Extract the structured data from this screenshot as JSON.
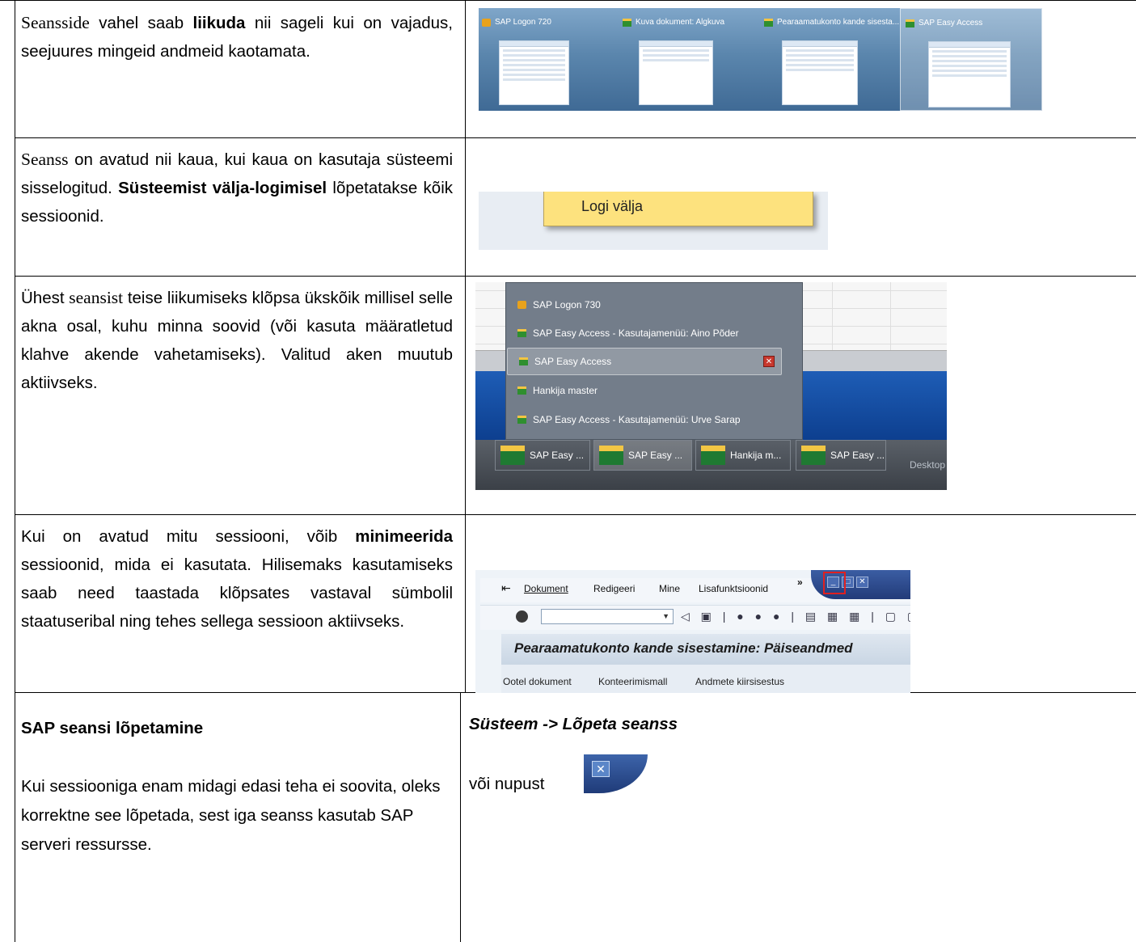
{
  "rows": [
    {
      "text_serif_lead": "Seansside",
      "text_parts": [
        " vahel saab ",
        "liikuda",
        " nii sageli kui on vajadus, seejuures mingeid andmeid kaotamata."
      ]
    },
    {
      "text_serif_lead": "Seanss",
      "text_parts": [
        " on avatud nii kaua, kui kaua on kasutaja süsteemi sisselogitud. ",
        "Süsteemist välja-logimisel",
        " lõpetatakse kõik sessioonid."
      ]
    },
    {
      "text_part1": "Ühest ",
      "text_serif": "seansist",
      "text_rest": " teise liikumiseks klõpsa ükskõik millisel selle akna osal, kuhu minna soovid (või kasuta määratletud klahve akende vahetamiseks). Valitud aken muutub aktiivseks."
    },
    {
      "text_parts": [
        "Kui on avatud mitu sessiooni, võib ",
        "minimeerida",
        " sessioonid, mida ei kasutata. Hilisemaks kasutamiseks saab need taastada klõpsates vastaval sümbolil staatuseribal ning tehes sellega sessioon aktiivseks."
      ]
    },
    {
      "heading": "SAP seansi lõpetamine",
      "text": "Kui sessiooniga enam midagi edasi teha ei soovita, oleks korrektne see lõpetada, sest iga seanss kasutab SAP serveri ressursse.",
      "right_heading": "Süsteem -> Lõpeta seanss",
      "right_text": "või nupust"
    }
  ],
  "screenshot1": {
    "thumbnails": [
      "SAP Logon 720",
      "Kuva dokument: Algkuva",
      "Pearaamatukonto kande sisesta...",
      "SAP Easy Access"
    ]
  },
  "screenshot2": {
    "menu_item": "Logi välja"
  },
  "screenshot3": {
    "items": [
      "SAP Logon 730",
      "SAP Easy Access  -  Kasutajamenüü: Aino Põder",
      "SAP Easy Access",
      "Hankija master",
      "SAP Easy Access  -  Kasutajamenüü: Urve Sarap"
    ],
    "taskbar_buttons": [
      "SAP Easy ...",
      "SAP Easy ...",
      "Hankija m...",
      "SAP Easy ..."
    ],
    "desktop_label": "Desktop"
  },
  "screenshot4": {
    "menu": [
      "Dokument",
      "Redigeeri",
      "Mine",
      "Lisafunktsioonid"
    ],
    "overflow": "»",
    "title": "Pearaamatukonto kande sisestamine: Päiseandmed",
    "app_toolbar": [
      "Ootel dokument",
      "Konteerimismall",
      "Andmete kiirsisestus"
    ]
  }
}
